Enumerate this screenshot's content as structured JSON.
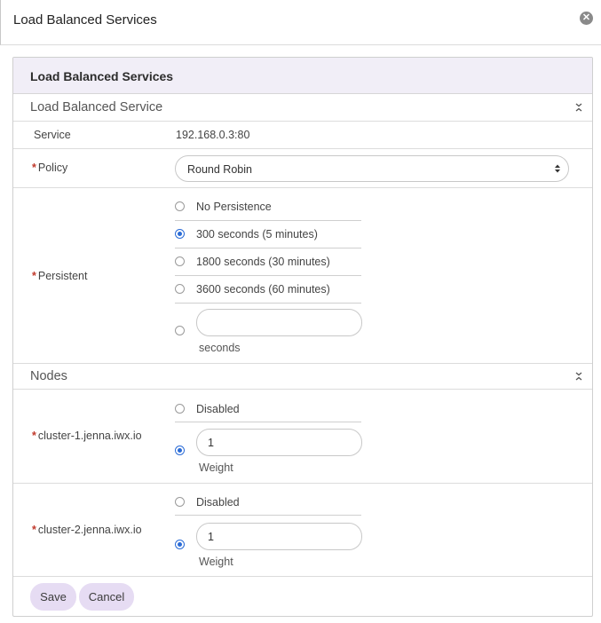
{
  "dialog": {
    "title": "Load Balanced Services",
    "close_icon": "close-circle-icon"
  },
  "panel": {
    "heading": "Load Balanced Services",
    "service_section": {
      "title": "Load Balanced Service",
      "collapse_icon": "collapse-chevrons-icon"
    },
    "service": {
      "label": "Service",
      "value": "192.168.0.3:80"
    },
    "policy": {
      "required_mark": "*",
      "label": "Policy",
      "selected": "Round Robin"
    },
    "persistent": {
      "required_mark": "*",
      "label": "Persistent",
      "options": [
        {
          "label": "No Persistence",
          "checked": false
        },
        {
          "label": "300 seconds (5 minutes)",
          "checked": true
        },
        {
          "label": "1800 seconds (30 minutes)",
          "checked": false
        },
        {
          "label": "3600 seconds (60 minutes)",
          "checked": false
        }
      ],
      "custom": {
        "value": "",
        "checked": false,
        "unit_label": "seconds"
      }
    },
    "nodes_section": {
      "title": "Nodes",
      "collapse_icon": "collapse-chevrons-icon"
    },
    "nodes": [
      {
        "required_mark": "*",
        "name": "cluster-1.jenna.iwx.io",
        "disabled_label": "Disabled",
        "disabled_checked": false,
        "weight_checked": true,
        "weight_value": "1",
        "weight_label": "Weight"
      },
      {
        "required_mark": "*",
        "name": "cluster-2.jenna.iwx.io",
        "disabled_label": "Disabled",
        "disabled_checked": false,
        "weight_checked": true,
        "weight_value": "1",
        "weight_label": "Weight"
      }
    ],
    "footer": {
      "save_label": "Save",
      "cancel_label": "Cancel"
    }
  },
  "colors": {
    "accent": "#2a6bd6",
    "required": "#c0392b",
    "button_bg": "#e6dcf3",
    "heading_bg": "#f1eef7"
  }
}
